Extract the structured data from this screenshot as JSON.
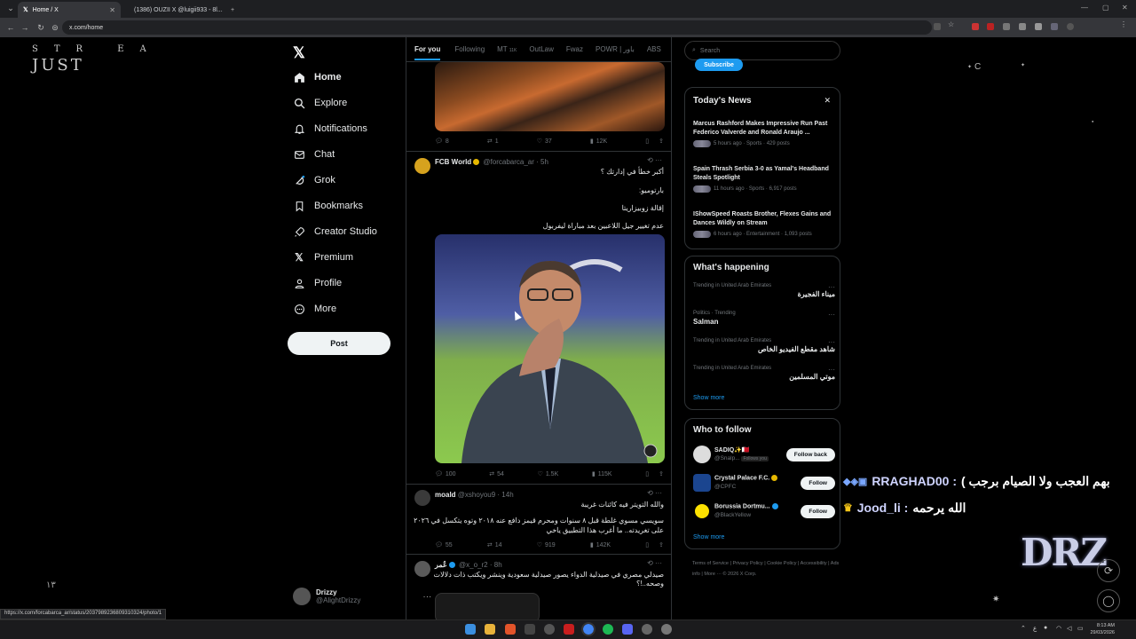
{
  "browser": {
    "tabs": [
      {
        "title": "Home / X",
        "active": true
      },
      {
        "title": "(1386) OUZII X @luigii933 - 8l...",
        "active": false
      }
    ],
    "address": "x.com/home",
    "status_url": "https://x.com/forcabarca_ar/status/2037989236809310324/photo/1"
  },
  "stream": {
    "logo_line1": "STR EA",
    "logo_line2": "JUST",
    "bottom_number": "١٣"
  },
  "sidebar": {
    "items": [
      {
        "label": "Home",
        "icon": "home-icon"
      },
      {
        "label": "Explore",
        "icon": "search-icon"
      },
      {
        "label": "Notifications",
        "icon": "bell-icon"
      },
      {
        "label": "Chat",
        "icon": "mail-icon"
      },
      {
        "label": "Grok",
        "icon": "grok-icon"
      },
      {
        "label": "Bookmarks",
        "icon": "bookmark-icon"
      },
      {
        "label": "Creator Studio",
        "icon": "rocket-icon"
      },
      {
        "label": "Premium",
        "icon": "x-icon"
      },
      {
        "label": "Profile",
        "icon": "person-icon"
      },
      {
        "label": "More",
        "icon": "more-circle-icon"
      }
    ],
    "post_label": "Post",
    "account": {
      "name": "Drizzy",
      "handle": "@AlightDrizzy"
    }
  },
  "timeline": {
    "tabs": [
      "For you",
      "Following",
      "MT",
      "OutLaw",
      "Fwaz",
      "POWR | باور",
      "ABS"
    ],
    "tab_mt_badge": "11K",
    "tweet1_actions": {
      "replies": "8",
      "reposts": "1",
      "likes": "37",
      "views": "12K"
    },
    "tweet2": {
      "name": "FCB World",
      "handle": "@forcabarca_ar",
      "time": "5h",
      "lines": [
        "أكبر خطأ في إدارتك ؟",
        "بارتوميو:",
        "إقالة زوبيزاريتا",
        "عدم تغيير جيل اللاعبين بعد مباراة ليفربول"
      ],
      "actions": {
        "replies": "100",
        "reposts": "54",
        "likes": "1.5K",
        "views": "115K"
      }
    },
    "tweet3": {
      "name": "moald",
      "handle": "@xshoyou9",
      "time": "14h",
      "lines": [
        "والله التويتر فيه كائنات غريبة",
        "سويسي مسوي غلطة قبل ٨ سنوات ومحرم قيمز دافع عنه ٢٠١٨ وتوه يتكسل في ٢٠٢٦",
        "على تغريدته.. ما أغرب هذا التطبيق ياخي"
      ],
      "actions": {
        "replies": "55",
        "reposts": "14",
        "likes": "919",
        "views": "142K"
      }
    },
    "tweet4": {
      "name": "عُمر",
      "handle": "@x_o_r2",
      "time": "8h",
      "lines": [
        "صيدلي مصري في صيدلية الدواء يصور صيدلية سعودية وينشر ويكتب ذات دلالات",
        "وصحه..!؟"
      ]
    }
  },
  "right": {
    "search_placeholder": "Search",
    "subscribe_label": "Subscribe",
    "news_title": "Today's News",
    "news": [
      {
        "title": "Marcus Rashford Makes Impressive Run Past Federico Valverde and Ronald Araujo ...",
        "meta": "5 hours ago · Sports · 429 posts"
      },
      {
        "title": "Spain Thrash Serbia 3-0 as Yamal's Headband Steals Spotlight",
        "meta": "11 hours ago · Sports · 6,917 posts"
      },
      {
        "title": "IShowSpeed Roasts Brother, Flexes Gains and Dances Wildly on Stream",
        "meta": "6 hours ago · Entertainment · 1,093 posts"
      }
    ],
    "happening_title": "What's happening",
    "trends": [
      {
        "context": "Trending in United Arab Emirates",
        "name": "ميناء الفجيرة"
      },
      {
        "context": "Politics · Trending",
        "name": "Salman"
      },
      {
        "context": "Trending in United Arab Emirates",
        "name": "شاهد مقطع الفيديو الخاص"
      },
      {
        "context": "Trending in United Arab Emirates",
        "name": "موتي المسلمين"
      }
    ],
    "show_more": "Show more",
    "who_title": "Who to follow",
    "follows": [
      {
        "name": "SADIQ✨🇧🇭",
        "handle": "@Snalp...",
        "badge": "Follows you",
        "button": "Follow back"
      },
      {
        "name": "Crystal Palace F.C.",
        "handle": "@CPFC",
        "badge": "",
        "button": "Follow"
      },
      {
        "name": "Borussia Dortmu...",
        "handle": "@BlackYellow",
        "badge": "",
        "button": "Follow"
      }
    ],
    "footer": "Terms of Service | Privacy Policy | Cookie Policy | Accessibility | Ads info | More ··· © 2026 X Corp."
  },
  "chat": {
    "line1_user": "RRAGHAD00 :",
    "line1_text": "بهم العجب ولا الصيام برجب )",
    "line2_user": "Jood_li :",
    "line2_text": "الله يرحمه"
  },
  "overlay": {
    "drz": "DRZ",
    "star_letter": "C"
  },
  "taskbar": {
    "time": "8:13 AM",
    "date": "29/03/2026",
    "lang": "ع"
  },
  "colors": {
    "accent": "#1d9bf0",
    "bg": "#000000",
    "border": "#2f3336",
    "muted": "#71767b"
  }
}
